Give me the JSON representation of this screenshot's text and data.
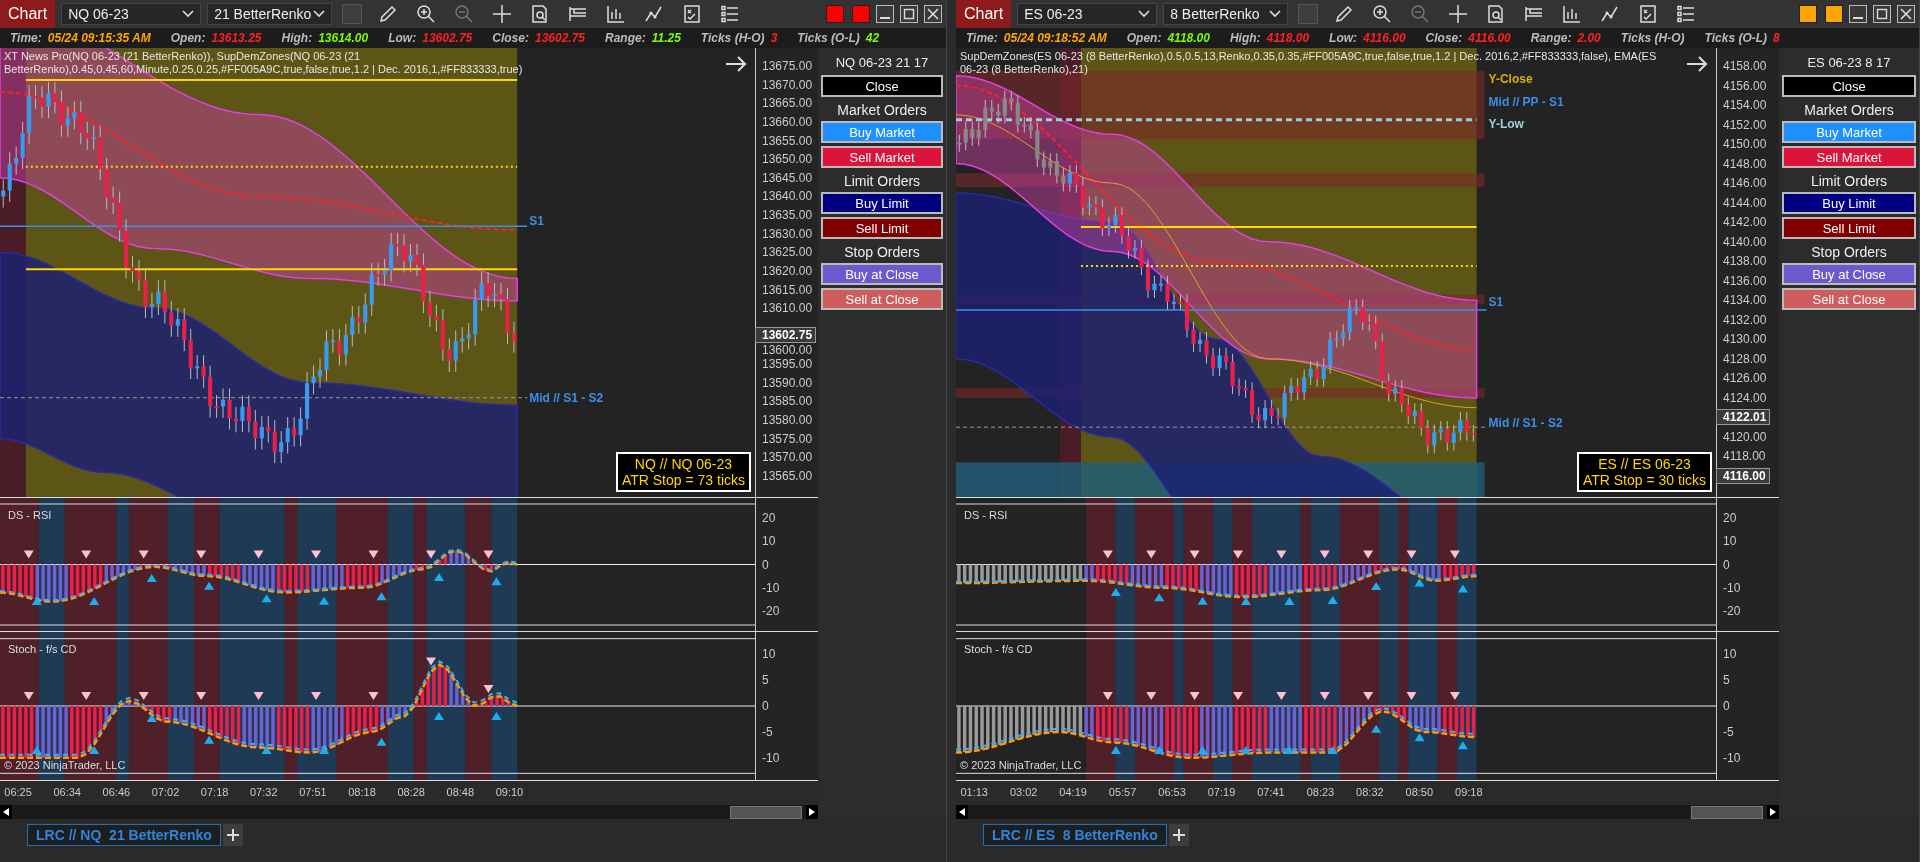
{
  "windows": [
    {
      "chart_button": "Chart",
      "instrument": "NQ 06-23",
      "bar_type": "21 BetterRenko",
      "color": "#ff0000",
      "info": [
        {
          "label": "Time:",
          "value": "05/24 09:15:35 AM",
          "color": "#ffa500"
        },
        {
          "label": "Open:",
          "value": "13613.25",
          "color": "#ff2020"
        },
        {
          "label": "High:",
          "value": "13614.00",
          "color": "#7cfc00"
        },
        {
          "label": "Low:",
          "value": "13602.75",
          "color": "#ff2020"
        },
        {
          "label": "Close:",
          "value": "13602.75",
          "color": "#ff2020"
        },
        {
          "label": "Range:",
          "value": "11.25",
          "color": "#7cfc00"
        },
        {
          "label": "Ticks (H-O)",
          "value": "3",
          "color": "#ff2020"
        },
        {
          "label": "Ticks (O-L)",
          "value": "42",
          "color": "#7cfc00"
        }
      ],
      "indicator_text": "XT News Pro(NQ 06-23 (21 BetterRenko)), SupDemZones(NQ 06-23 (21 BetterRenko),0.45,0.45,60,Minute,0.25,0.25,#FF005A9C,true,false,true,1.2 | Dec. 2016,1,#FF833333,true)",
      "price_axis": [
        "13675.00",
        "13670.00",
        "13665.00",
        "13660.00",
        "13655.00",
        "13650.00",
        "13645.00",
        "13640.00",
        "13635.00",
        "13630.00",
        "13625.00",
        "13620.00",
        "13615.00",
        "13610.00",
        "13600.00",
        "13595.00",
        "13590.00",
        "13585.00",
        "13580.00",
        "13575.00",
        "13570.00",
        "13565.00"
      ],
      "price_markers": [
        "13602.75"
      ],
      "chart_labels": [
        {
          "text": "S1",
          "color": "#3d8ee8"
        },
        {
          "text": "Mid // S1 - S2",
          "color": "#3d8ee8"
        }
      ],
      "atr_box": [
        "NQ // NQ 06-23",
        "ATR Stop = 73 ticks"
      ],
      "panels": [
        {
          "title": "DS - RSI",
          "axis": [
            "20",
            "10",
            "0",
            "-10",
            "-20"
          ]
        },
        {
          "title": "Stoch - f/s CD",
          "axis": [
            "10",
            "5",
            "0",
            "-5",
            "-10"
          ]
        }
      ],
      "copyright": "© 2023 NinjaTrader, LLC",
      "time_axis": [
        "06:25",
        "06:34",
        "06:46",
        "07:02",
        "07:18",
        "07:32",
        "07:51",
        "08:18",
        "08:28",
        "08:48",
        "09:10"
      ],
      "order_panel": {
        "header": "NQ 06-23 21 17",
        "items": [
          {
            "kind": "button",
            "label": "Close",
            "color": "#000000"
          },
          {
            "kind": "heading",
            "label": "Market Orders"
          },
          {
            "kind": "button",
            "label": "Buy Market",
            "color": "#1e90ff"
          },
          {
            "kind": "button",
            "label": "Sell Market",
            "color": "#dc143c"
          },
          {
            "kind": "heading",
            "label": "Limit Orders"
          },
          {
            "kind": "button",
            "label": "Buy Limit",
            "color": "#000080"
          },
          {
            "kind": "button",
            "label": "Sell Limit",
            "color": "#800000"
          },
          {
            "kind": "heading",
            "label": "Stop Orders"
          },
          {
            "kind": "button",
            "label": "Buy at Close",
            "color": "#6a5acd"
          },
          {
            "kind": "button",
            "label": "Sell at Close",
            "color": "#cd5c5c"
          }
        ]
      },
      "tabs": [
        {
          "label": "LRC // NQ  21 BetterRenko",
          "selected": true
        }
      ]
    },
    {
      "chart_button": "Chart",
      "instrument": "ES 06-23",
      "bar_type": "8 BetterRenko",
      "color": "#ffa500",
      "info": [
        {
          "label": "Time:",
          "value": "05/24 09:18:52 AM",
          "color": "#ffa500"
        },
        {
          "label": "Open:",
          "value": "4118.00",
          "color": "#7cfc00"
        },
        {
          "label": "High:",
          "value": "4118.00",
          "color": "#ff2020"
        },
        {
          "label": "Low:",
          "value": "4116.00",
          "color": "#ff2020"
        },
        {
          "label": "Close:",
          "value": "4116.00",
          "color": "#ff2020"
        },
        {
          "label": "Range:",
          "value": "2.00",
          "color": "#ff2020"
        },
        {
          "label": "Ticks (H-O)"
        },
        {
          "label": "Ticks (O-L)",
          "value": "8",
          "color": "#ff2020"
        }
      ],
      "indicator_text": "SupDemZones(ES 06-23 (8 BetterRenko),0.5,0.5,13,Renko,0.35,0.35,#FF005A9C,true,false,true,1.2 | Dec. 2016,2,#FF833333,false), EMA(ES 06-23 (8 BetterRenko),21)",
      "price_axis": [
        "4158.00",
        "4156.00",
        "4154.00",
        "4152.00",
        "4150.00",
        "4148.00",
        "4146.00",
        "4144.00",
        "4142.00",
        "4140.00",
        "4138.00",
        "4136.00",
        "4134.00",
        "4132.00",
        "4130.00",
        "4128.00",
        "4126.00",
        "4124.00",
        "4120.00",
        "4118.00"
      ],
      "price_markers": [
        "4122.01",
        "4116.00"
      ],
      "chart_labels": [
        {
          "text": "Y-Close",
          "color": "#d4b000"
        },
        {
          "text": "Mid // PP - S1",
          "color": "#3d8ee8"
        },
        {
          "text": "Y-Low",
          "color": "#9ecfe0"
        },
        {
          "text": "S1",
          "color": "#3d8ee8"
        },
        {
          "text": "Mid // S1 - S2",
          "color": "#3d8ee8"
        }
      ],
      "atr_box": [
        "ES // ES 06-23",
        "ATR Stop = 30 ticks"
      ],
      "panels": [
        {
          "title": "DS - RSI",
          "axis": [
            "20",
            "10",
            "0",
            "-10",
            "-20"
          ]
        },
        {
          "title": "Stoch - f/s CD",
          "axis": [
            "10",
            "5",
            "0",
            "-5",
            "-10"
          ]
        }
      ],
      "copyright": "© 2023 NinjaTrader, LLC",
      "time_axis": [
        "01:13",
        "03:02",
        "04:19",
        "05:57",
        "06:53",
        "07:19",
        "07:41",
        "08:23",
        "08:32",
        "08:50",
        "09:18"
      ],
      "order_panel": {
        "header": "ES 06-23 8 17",
        "items": [
          {
            "kind": "button",
            "label": "Close",
            "color": "#000000"
          },
          {
            "kind": "heading",
            "label": "Market Orders"
          },
          {
            "kind": "button",
            "label": "Buy Market",
            "color": "#1e90ff"
          },
          {
            "kind": "button",
            "label": "Sell Market",
            "color": "#dc143c"
          },
          {
            "kind": "heading",
            "label": "Limit Orders"
          },
          {
            "kind": "button",
            "label": "Buy Limit",
            "color": "#000080"
          },
          {
            "kind": "button",
            "label": "Sell Limit",
            "color": "#800000"
          },
          {
            "kind": "heading",
            "label": "Stop Orders"
          },
          {
            "kind": "button",
            "label": "Buy at Close",
            "color": "#6a5acd"
          },
          {
            "kind": "button",
            "label": "Sell at Close",
            "color": "#cd5c5c"
          }
        ]
      },
      "tabs": [
        {
          "label": "LRC // ES  8 BetterRenko",
          "selected": true
        }
      ]
    }
  ]
}
